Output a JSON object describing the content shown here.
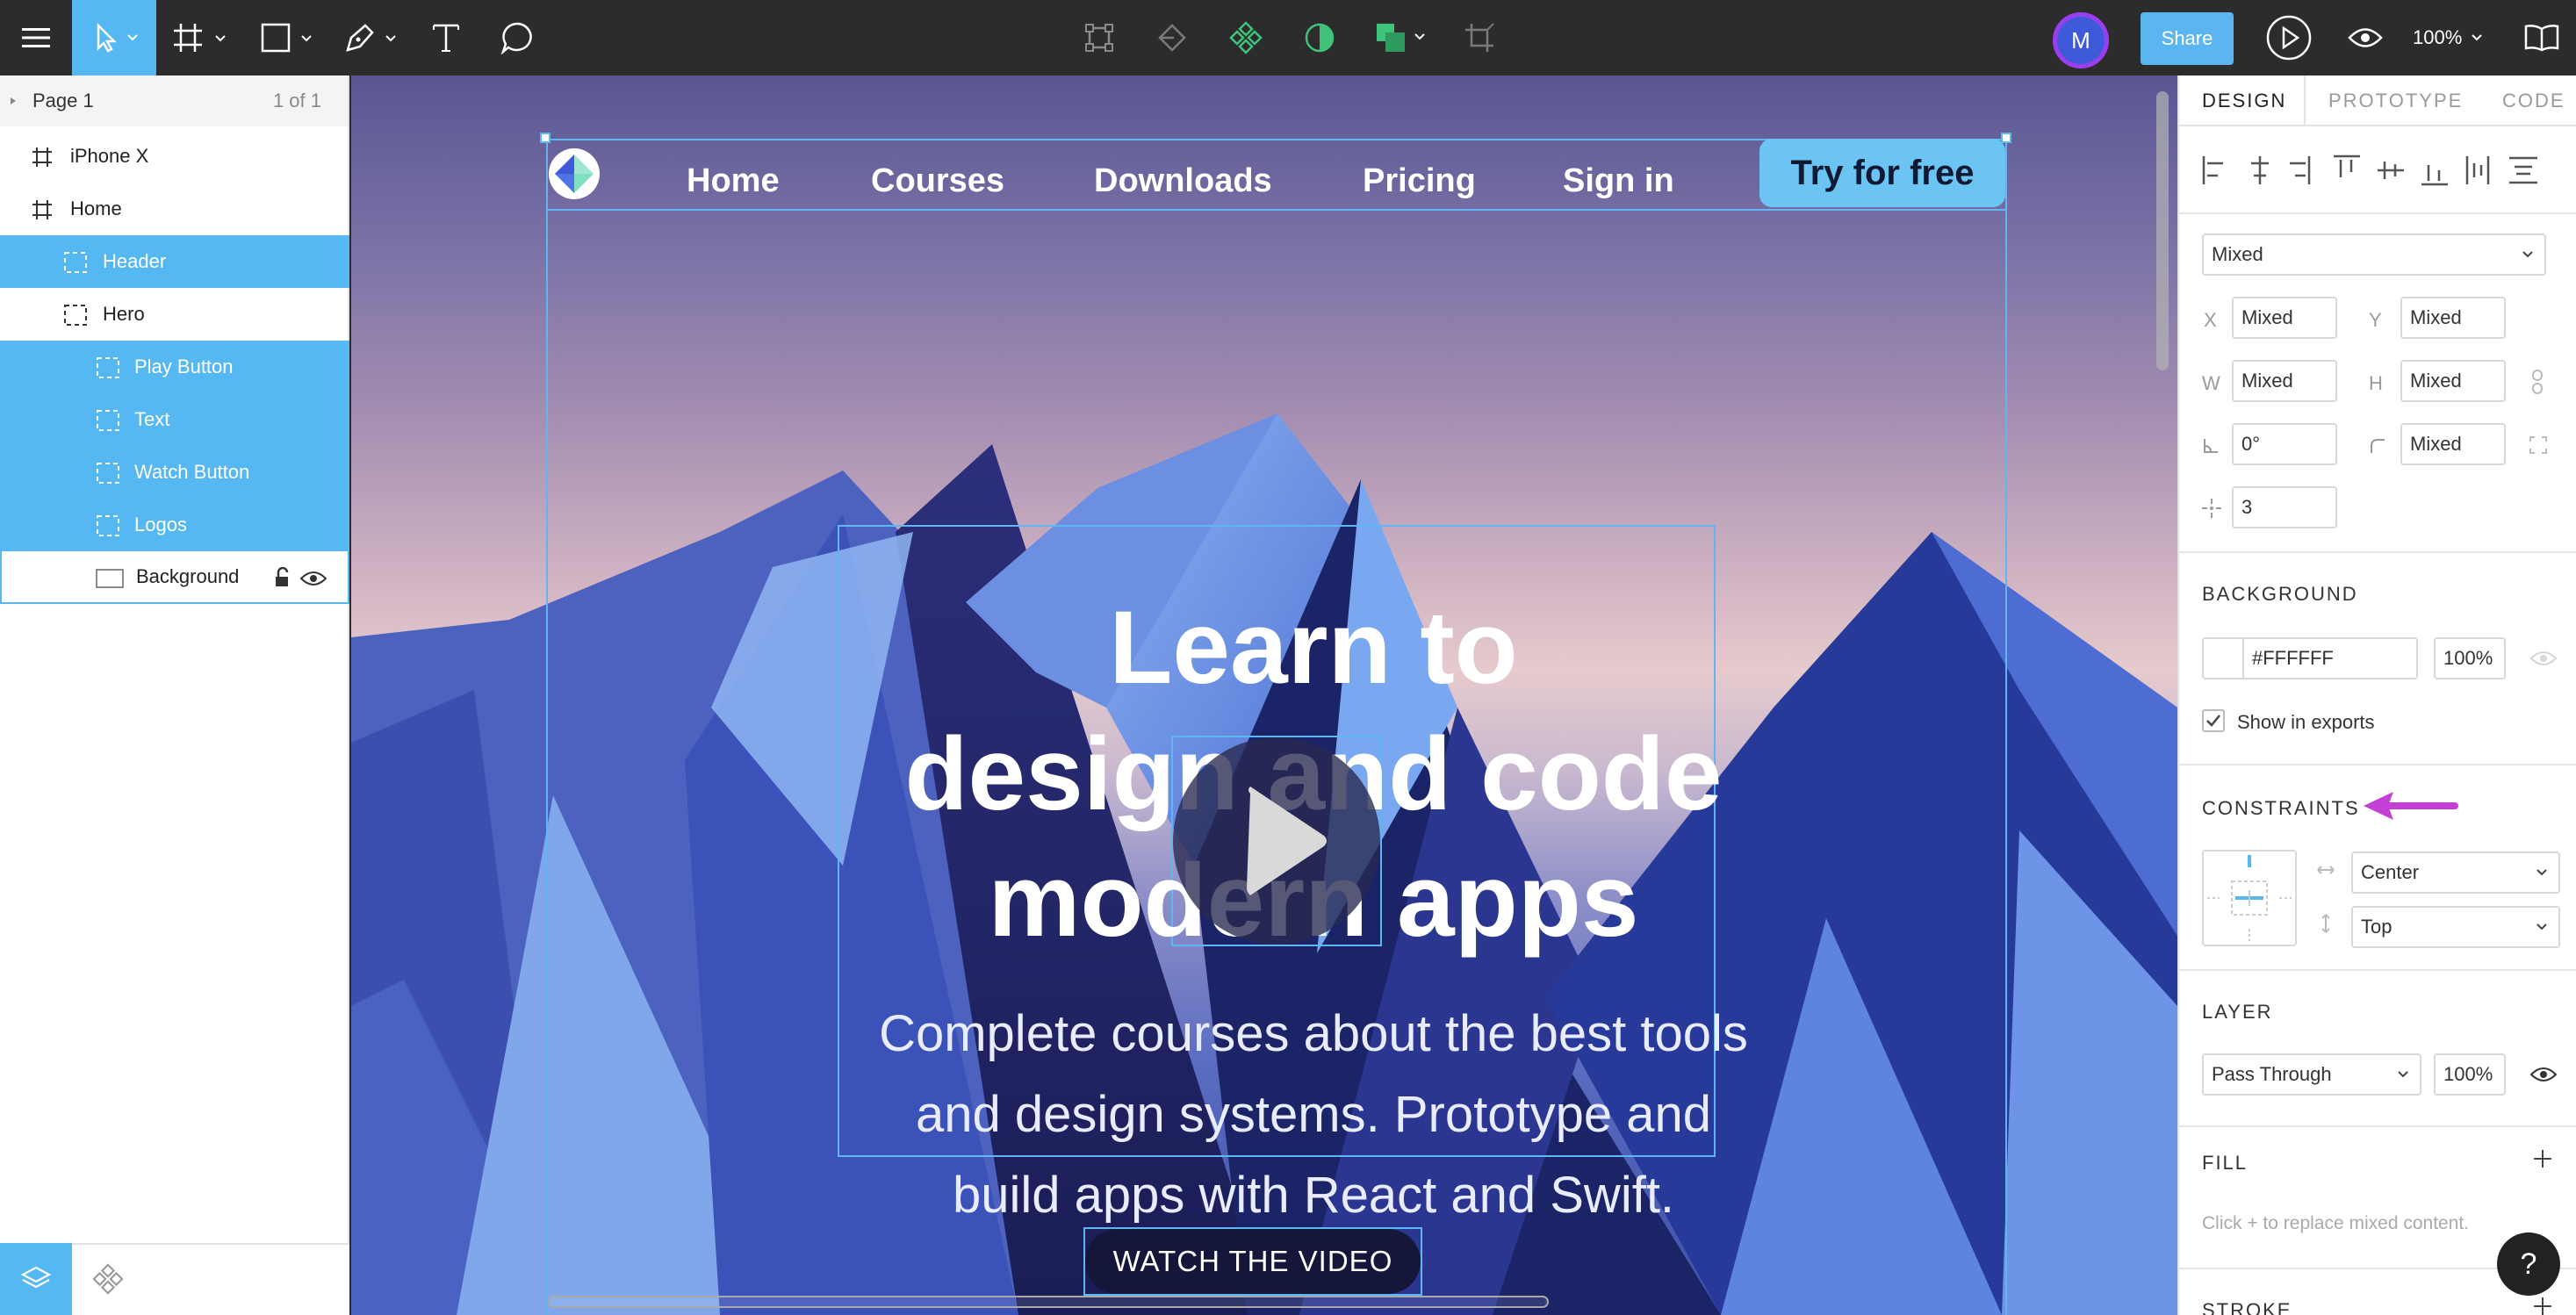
{
  "toolbar": {
    "share_label": "Share",
    "avatar_initial": "M",
    "zoom_label": "100%",
    "colors": {
      "background": "#2c2c2c",
      "active_tool": "#56b8f2",
      "share": "#5bb6f0",
      "avatar_ring": "#9a3ff0"
    },
    "icons": [
      "menu-icon",
      "move-tool-icon",
      "frame-tool-icon",
      "rectangle-tool-icon",
      "pen-tool-icon",
      "text-tool-icon",
      "comment-tool-icon",
      "transform-icon",
      "boolean-icon",
      "component-icon",
      "mask-icon",
      "fill-icon",
      "crop-icon",
      "play-icon",
      "preview-eye-icon",
      "book-icon"
    ]
  },
  "layers": {
    "page_label": "Page 1",
    "page_count": "1 of 1",
    "items": [
      {
        "label": "iPhone X"
      },
      {
        "label": "Home"
      },
      {
        "label": "Header"
      },
      {
        "label": "Hero"
      },
      {
        "label": "Play Button"
      },
      {
        "label": "Text"
      },
      {
        "label": "Watch Button"
      },
      {
        "label": "Logos"
      },
      {
        "label": "Background"
      }
    ]
  },
  "canvas": {
    "nav": {
      "links": [
        "Home",
        "Courses",
        "Downloads",
        "Pricing",
        "Sign in"
      ],
      "cta": "Try for free"
    },
    "hero": {
      "title_lines": [
        "Learn to",
        "design and code",
        "modern apps"
      ],
      "subtitle_lines": [
        "Complete courses about the best tools",
        "and design systems. Prototype and",
        "build apps with React and Swift."
      ],
      "watch_label": "WATCH THE VIDEO"
    }
  },
  "inspector": {
    "tabs": [
      "DESIGN",
      "PROTOTYPE",
      "CODE"
    ],
    "style_select": "Mixed",
    "x_label": "X",
    "x_value": "Mixed",
    "y_label": "Y",
    "y_value": "Mixed",
    "w_label": "W",
    "w_value": "Mixed",
    "h_label": "H",
    "h_value": "Mixed",
    "rotation_value": "0°",
    "radius_value": "Mixed",
    "spacing_value": "3",
    "background": {
      "title": "BACKGROUND",
      "hex": "#FFFFFF",
      "opacity": "100%",
      "show_in_exports": "Show in exports"
    },
    "constraints": {
      "title": "CONSTRAINTS",
      "horizontal": "Center",
      "vertical": "Top"
    },
    "layer": {
      "title": "LAYER",
      "blend": "Pass Through",
      "opacity": "100%"
    },
    "fill": {
      "title": "FILL",
      "hint": "Click + to replace mixed content."
    },
    "stroke": {
      "title": "STROKE"
    },
    "help": "?"
  }
}
